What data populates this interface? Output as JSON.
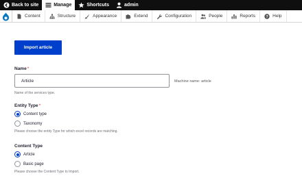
{
  "toolbar": {
    "items": [
      {
        "label": "Back to site",
        "icon": "back-arrow-icon"
      },
      {
        "label": "Manage",
        "icon": "hamburger-icon"
      },
      {
        "label": "Shortcuts",
        "icon": "star-icon"
      },
      {
        "label": "admin",
        "icon": "user-icon"
      }
    ]
  },
  "tray": {
    "items": [
      {
        "label": "Content",
        "icon": "document-icon"
      },
      {
        "label": "Structure",
        "icon": "sitemap-icon"
      },
      {
        "label": "Appearance",
        "icon": "brush-icon"
      },
      {
        "label": "Extend",
        "icon": "puzzle-icon"
      },
      {
        "label": "Configuration",
        "icon": "wrench-icon"
      },
      {
        "label": "People",
        "icon": "people-icon"
      },
      {
        "label": "Reports",
        "icon": "chart-icon"
      },
      {
        "label": "Help",
        "icon": "help-icon"
      }
    ]
  },
  "main": {
    "import_button": "Import article",
    "name_label": "Name",
    "required_marker": "*",
    "name_value": "Article",
    "machine_name": "Machine name: article",
    "name_description": "Name of the services type.",
    "entity_type": {
      "label": "Entity Type",
      "options": [
        "Content type",
        "Taxonomy"
      ],
      "selected": "Content type",
      "description": "Please choose the entity Type for which excel records are matching."
    },
    "content_type": {
      "label": "Content Type",
      "options": [
        "Article",
        "Basic page"
      ],
      "selected": "Article",
      "description": "Please choose the Content Type to Import."
    }
  },
  "colors": {
    "accent": "#003ecc",
    "toolbar_bg": "#0f0f0f",
    "required": "#dc2323"
  }
}
